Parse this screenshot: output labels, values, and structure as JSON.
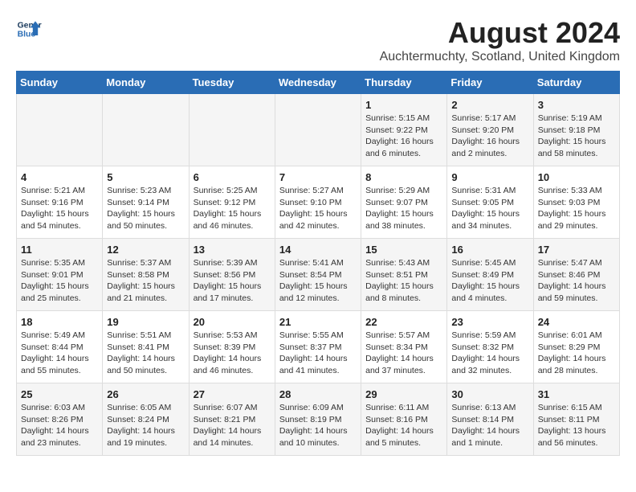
{
  "logo": {
    "line1": "General",
    "line2": "Blue"
  },
  "title": "August 2024",
  "subtitle": "Auchtermuchty, Scotland, United Kingdom",
  "weekdays": [
    "Sunday",
    "Monday",
    "Tuesday",
    "Wednesday",
    "Thursday",
    "Friday",
    "Saturday"
  ],
  "weeks": [
    [
      {
        "day": "",
        "info": ""
      },
      {
        "day": "",
        "info": ""
      },
      {
        "day": "",
        "info": ""
      },
      {
        "day": "",
        "info": ""
      },
      {
        "day": "1",
        "info": "Sunrise: 5:15 AM\nSunset: 9:22 PM\nDaylight: 16 hours\nand 6 minutes."
      },
      {
        "day": "2",
        "info": "Sunrise: 5:17 AM\nSunset: 9:20 PM\nDaylight: 16 hours\nand 2 minutes."
      },
      {
        "day": "3",
        "info": "Sunrise: 5:19 AM\nSunset: 9:18 PM\nDaylight: 15 hours\nand 58 minutes."
      }
    ],
    [
      {
        "day": "4",
        "info": "Sunrise: 5:21 AM\nSunset: 9:16 PM\nDaylight: 15 hours\nand 54 minutes."
      },
      {
        "day": "5",
        "info": "Sunrise: 5:23 AM\nSunset: 9:14 PM\nDaylight: 15 hours\nand 50 minutes."
      },
      {
        "day": "6",
        "info": "Sunrise: 5:25 AM\nSunset: 9:12 PM\nDaylight: 15 hours\nand 46 minutes."
      },
      {
        "day": "7",
        "info": "Sunrise: 5:27 AM\nSunset: 9:10 PM\nDaylight: 15 hours\nand 42 minutes."
      },
      {
        "day": "8",
        "info": "Sunrise: 5:29 AM\nSunset: 9:07 PM\nDaylight: 15 hours\nand 38 minutes."
      },
      {
        "day": "9",
        "info": "Sunrise: 5:31 AM\nSunset: 9:05 PM\nDaylight: 15 hours\nand 34 minutes."
      },
      {
        "day": "10",
        "info": "Sunrise: 5:33 AM\nSunset: 9:03 PM\nDaylight: 15 hours\nand 29 minutes."
      }
    ],
    [
      {
        "day": "11",
        "info": "Sunrise: 5:35 AM\nSunset: 9:01 PM\nDaylight: 15 hours\nand 25 minutes."
      },
      {
        "day": "12",
        "info": "Sunrise: 5:37 AM\nSunset: 8:58 PM\nDaylight: 15 hours\nand 21 minutes."
      },
      {
        "day": "13",
        "info": "Sunrise: 5:39 AM\nSunset: 8:56 PM\nDaylight: 15 hours\nand 17 minutes."
      },
      {
        "day": "14",
        "info": "Sunrise: 5:41 AM\nSunset: 8:54 PM\nDaylight: 15 hours\nand 12 minutes."
      },
      {
        "day": "15",
        "info": "Sunrise: 5:43 AM\nSunset: 8:51 PM\nDaylight: 15 hours\nand 8 minutes."
      },
      {
        "day": "16",
        "info": "Sunrise: 5:45 AM\nSunset: 8:49 PM\nDaylight: 15 hours\nand 4 minutes."
      },
      {
        "day": "17",
        "info": "Sunrise: 5:47 AM\nSunset: 8:46 PM\nDaylight: 14 hours\nand 59 minutes."
      }
    ],
    [
      {
        "day": "18",
        "info": "Sunrise: 5:49 AM\nSunset: 8:44 PM\nDaylight: 14 hours\nand 55 minutes."
      },
      {
        "day": "19",
        "info": "Sunrise: 5:51 AM\nSunset: 8:41 PM\nDaylight: 14 hours\nand 50 minutes."
      },
      {
        "day": "20",
        "info": "Sunrise: 5:53 AM\nSunset: 8:39 PM\nDaylight: 14 hours\nand 46 minutes."
      },
      {
        "day": "21",
        "info": "Sunrise: 5:55 AM\nSunset: 8:37 PM\nDaylight: 14 hours\nand 41 minutes."
      },
      {
        "day": "22",
        "info": "Sunrise: 5:57 AM\nSunset: 8:34 PM\nDaylight: 14 hours\nand 37 minutes."
      },
      {
        "day": "23",
        "info": "Sunrise: 5:59 AM\nSunset: 8:32 PM\nDaylight: 14 hours\nand 32 minutes."
      },
      {
        "day": "24",
        "info": "Sunrise: 6:01 AM\nSunset: 8:29 PM\nDaylight: 14 hours\nand 28 minutes."
      }
    ],
    [
      {
        "day": "25",
        "info": "Sunrise: 6:03 AM\nSunset: 8:26 PM\nDaylight: 14 hours\nand 23 minutes."
      },
      {
        "day": "26",
        "info": "Sunrise: 6:05 AM\nSunset: 8:24 PM\nDaylight: 14 hours\nand 19 minutes."
      },
      {
        "day": "27",
        "info": "Sunrise: 6:07 AM\nSunset: 8:21 PM\nDaylight: 14 hours\nand 14 minutes."
      },
      {
        "day": "28",
        "info": "Sunrise: 6:09 AM\nSunset: 8:19 PM\nDaylight: 14 hours\nand 10 minutes."
      },
      {
        "day": "29",
        "info": "Sunrise: 6:11 AM\nSunset: 8:16 PM\nDaylight: 14 hours\nand 5 minutes."
      },
      {
        "day": "30",
        "info": "Sunrise: 6:13 AM\nSunset: 8:14 PM\nDaylight: 14 hours\nand 1 minute."
      },
      {
        "day": "31",
        "info": "Sunrise: 6:15 AM\nSunset: 8:11 PM\nDaylight: 13 hours\nand 56 minutes."
      }
    ]
  ]
}
